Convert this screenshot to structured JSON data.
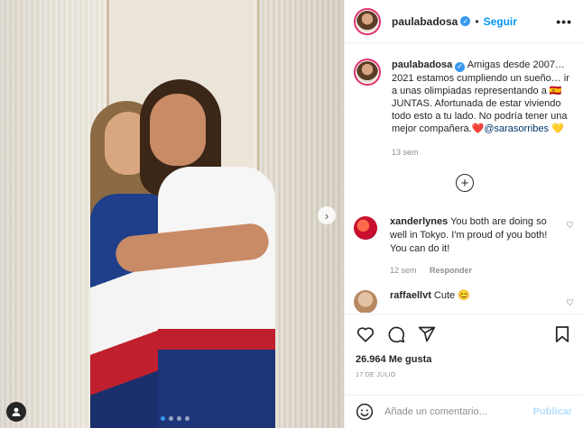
{
  "post": {
    "username": "paulabadosa",
    "follow_label": "Seguir",
    "separator": "•",
    "more_label": "•••",
    "caption_text": "Amigas desde 2007… 2021 estamos cumpliendo un sueño… ir a unas olimpiadas representando a 🇪🇸 JUNTAS. Afortunada de estar viviendo todo esto a tu lado. No podría tener una mejor compañera.❤️",
    "caption_mention": "@sarasorribes",
    "caption_emoji": "💛",
    "caption_age": "13 sem"
  },
  "comments": [
    {
      "username": "xanderlynes",
      "text": "You both are doing so well in Tokyo. I'm proud of you both! You can do it!",
      "age": "12 sem",
      "reply_label": "Responder"
    },
    {
      "username": "raffaellvt",
      "text": "Cute 😊"
    }
  ],
  "actions": {
    "likes": "26.964 Me gusta",
    "date": "17 DE JULIO"
  },
  "add_comment": {
    "placeholder": "Añade un comentario...",
    "post_label": "Publicar"
  },
  "carousel": {
    "current_index": 1,
    "total": 4
  },
  "icons": [
    "verified-badge-icon",
    "more-options-icon",
    "load-more-comments-icon",
    "like-icon",
    "comment-icon",
    "share-icon",
    "save-icon",
    "emoji-icon",
    "next-arrow-icon",
    "tagged-user-icon"
  ],
  "colors": {
    "follow": "#0095f6",
    "verified": "#3897f0",
    "muted": "#8e8e8e",
    "post_disabled": "#b2dffc"
  }
}
